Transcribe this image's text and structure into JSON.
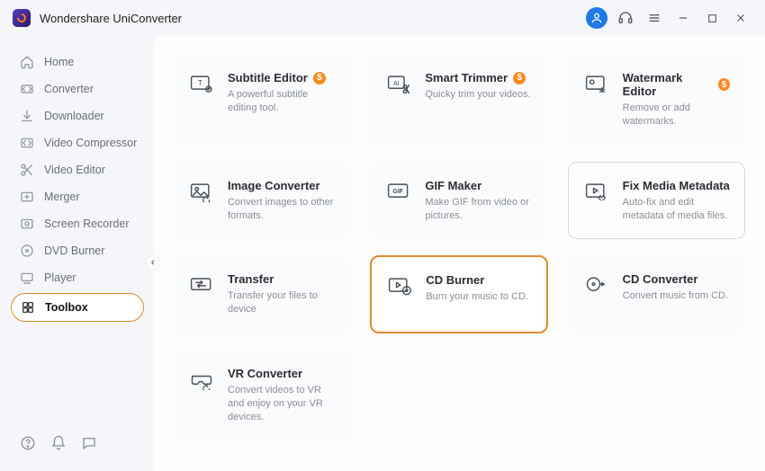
{
  "app": {
    "title": "Wondershare UniConverter"
  },
  "titlebar": {
    "avatar_glyph": "👤",
    "headset_glyph": "🎧"
  },
  "sidebar": {
    "items": [
      {
        "label": "Home",
        "icon": "home-icon"
      },
      {
        "label": "Converter",
        "icon": "converter-icon"
      },
      {
        "label": "Downloader",
        "icon": "download-icon"
      },
      {
        "label": "Video Compressor",
        "icon": "compress-icon"
      },
      {
        "label": "Video Editor",
        "icon": "scissors-icon"
      },
      {
        "label": "Merger",
        "icon": "merger-icon"
      },
      {
        "label": "Screen Recorder",
        "icon": "record-icon"
      },
      {
        "label": "DVD Burner",
        "icon": "disc-icon"
      },
      {
        "label": "Player",
        "icon": "player-icon"
      },
      {
        "label": "Toolbox",
        "icon": "toolbox-icon",
        "active": true
      }
    ]
  },
  "tools": [
    {
      "title": "Subtitle Editor",
      "desc": "A powerful subtitle editing tool.",
      "icon": "subtitle-icon",
      "badge": "$"
    },
    {
      "title": "Smart Trimmer",
      "desc": "Quicky trim your videos.",
      "icon": "trimmer-icon",
      "badge": "$"
    },
    {
      "title": "Watermark Editor",
      "desc": "Remove or add watermarks.",
      "icon": "watermark-icon",
      "badge": "$"
    },
    {
      "title": "Image Converter",
      "desc": "Convert images to other formats.",
      "icon": "image-icon"
    },
    {
      "title": "GIF Maker",
      "desc": "Make GIF from video or pictures.",
      "icon": "gif-icon"
    },
    {
      "title": "Fix Media Metadata",
      "desc": "Auto-fix and edit metadata of media files.",
      "icon": "metadata-icon",
      "outlined": true
    },
    {
      "title": "Transfer",
      "desc": "Transfer your files to device",
      "icon": "transfer-icon"
    },
    {
      "title": "CD Burner",
      "desc": "Burn your music to CD.",
      "icon": "cdburner-icon",
      "selected": true
    },
    {
      "title": "CD Converter",
      "desc": "Convert music from CD.",
      "icon": "cdconvert-icon"
    },
    {
      "title": "VR Converter",
      "desc": "Convert videos to VR and enjoy on your VR devices.",
      "icon": "vr-icon"
    }
  ]
}
